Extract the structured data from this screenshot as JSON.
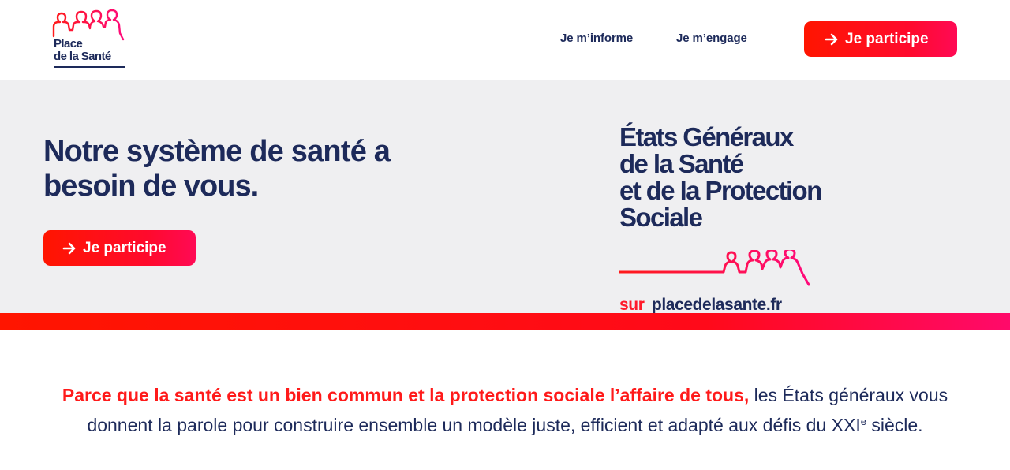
{
  "header": {
    "logo": {
      "line1": "Place",
      "line2": "de la Santé"
    },
    "nav": [
      {
        "label": "Je m’informe"
      },
      {
        "label": "Je m’engage"
      }
    ],
    "cta_label": "Je participe"
  },
  "hero": {
    "headline_regular": "Notre système de santé a",
    "headline_bold": "besoin de vous.",
    "cta_label": "Je participe",
    "etats_generaux": {
      "lines": [
        "États Généraux",
        "de la Santé",
        "et de la Protection",
        "Sociale"
      ],
      "url_prefix": "sur",
      "url_site": "placedelasante.fr"
    }
  },
  "intro": {
    "highlight": "Parce que la santé est un bien commun et la protection sociale l’affaire de tous,",
    "text_part1": " les États généraux vous donnent la parole pour construire ensemble un modèle juste, efficient et adapté aux défis du ",
    "century": "XXI",
    "century_sup": "e",
    "text_part2": " siècle."
  },
  "colors": {
    "navy": "#1d2a5a",
    "red": "#ff1500",
    "pink": "#ff0a6a",
    "hero_bg": "#efeff1"
  },
  "icons": {
    "cta_arrow": "arrow-right-icon",
    "logo_people": "people-outline-icon"
  }
}
